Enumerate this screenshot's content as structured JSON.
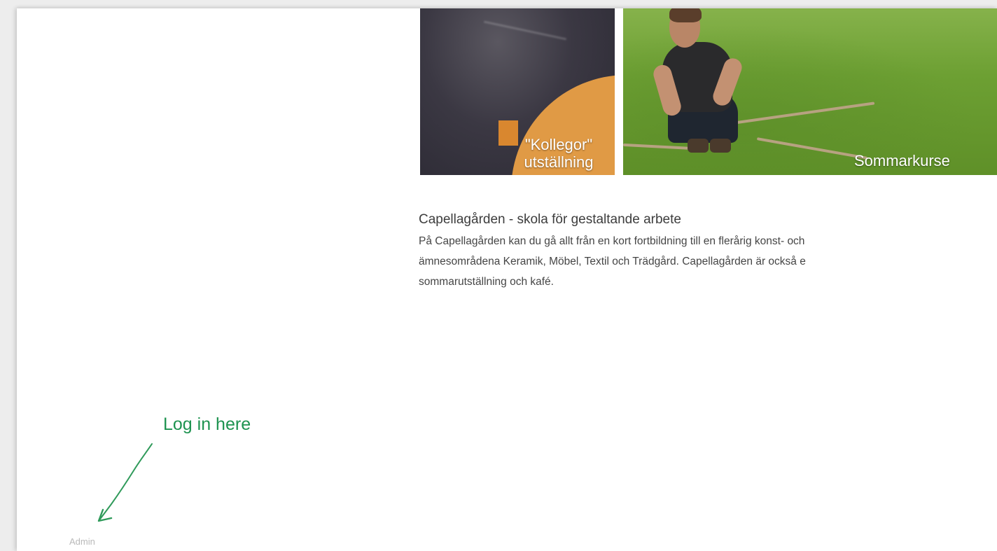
{
  "tiles": {
    "kollegor": {
      "caption_line1": "\"Kollegor\"",
      "caption_line2": "utställning"
    },
    "sommar": {
      "caption": "Sommarkurse"
    }
  },
  "intro": {
    "title": "Capellagården - skola för gestaltande arbete",
    "line1": "På Capellagården kan du gå allt från en kort fortbildning till en flerårig konst- och",
    "line2": "ämnesområdena Keramik, Möbel, Textil och Trädgård. Capellagården är också e",
    "line3": "sommarutställning och kafé."
  },
  "annotation": {
    "text": "Log in here",
    "color": "#1e9350"
  },
  "footer": {
    "admin_label": "Admin"
  }
}
